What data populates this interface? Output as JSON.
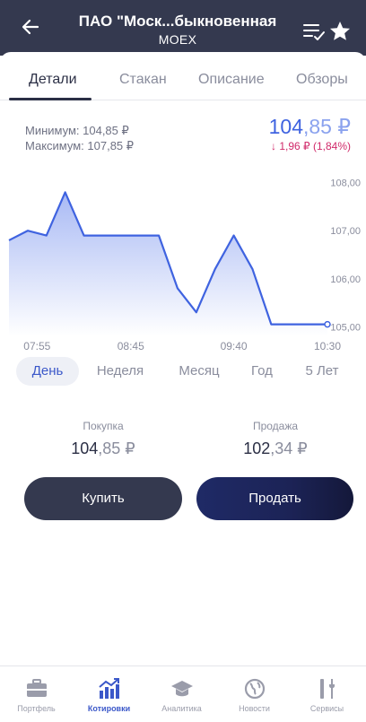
{
  "header": {
    "title": "ПАО \"Моск...быкновенная",
    "ticker": "MOEX"
  },
  "tabs": [
    {
      "label": "Детали",
      "active": true
    },
    {
      "label": "Стакан",
      "active": false
    },
    {
      "label": "Описание",
      "active": false
    },
    {
      "label": "Обзоры",
      "active": false
    }
  ],
  "summary": {
    "min_label": "Минимум: 104,85 ₽",
    "max_label": "Максимум: 107,85 ₽",
    "price_int": "104",
    "price_dec": ",85 ₽",
    "change": "↓ 1,96 ₽ (1,84%)"
  },
  "chart_data": {
    "type": "area",
    "x": [
      "07:40",
      "07:50",
      "08:00",
      "08:10",
      "08:20",
      "08:30",
      "08:40",
      "08:50",
      "09:00",
      "09:10",
      "09:20",
      "09:30",
      "09:40",
      "09:50",
      "10:00",
      "10:10",
      "10:20",
      "10:30"
    ],
    "series": [
      {
        "values": [
          106.8,
          107.0,
          106.9,
          107.8,
          106.9,
          106.9,
          106.9,
          106.9,
          106.9,
          105.8,
          105.3,
          106.2,
          106.9,
          106.2,
          105.05,
          105.05,
          105.05,
          105.05
        ]
      }
    ],
    "x_ticks": [
      "07:55",
      "08:45",
      "09:40",
      "10:30"
    ],
    "y_ticks": [
      "108,00",
      "107,00",
      "106,00",
      "105,00"
    ],
    "ylim": [
      104.8,
      108.2
    ],
    "grid": false,
    "colors": {
      "line": "#3f63e0",
      "fill_top": "#9fb2f3",
      "fill_bottom": "#ffffff"
    }
  },
  "periods": [
    {
      "label": "День",
      "active": true
    },
    {
      "label": "Неделя",
      "active": false
    },
    {
      "label": "Месяц",
      "active": false
    },
    {
      "label": "Год",
      "active": false
    },
    {
      "label": "5 Лет",
      "active": false
    }
  ],
  "quotes": {
    "buy_label": "Покупка",
    "buy_int": "104",
    "buy_dec": ",85 ₽",
    "sell_label": "Продажа",
    "sell_int": "102",
    "sell_dec": ",34 ₽"
  },
  "actions": {
    "buy": "Купить",
    "sell": "Продать"
  },
  "bottom_nav": [
    {
      "label": "Портфель",
      "icon": "briefcase-icon",
      "active": false
    },
    {
      "label": "Котировки",
      "icon": "bar-chart-icon",
      "active": true
    },
    {
      "label": "Аналитика",
      "icon": "graduation-cap-icon",
      "active": false
    },
    {
      "label": "Новости",
      "icon": "globe-icon",
      "active": false
    },
    {
      "label": "Сервисы",
      "icon": "tools-icon",
      "active": false
    }
  ]
}
